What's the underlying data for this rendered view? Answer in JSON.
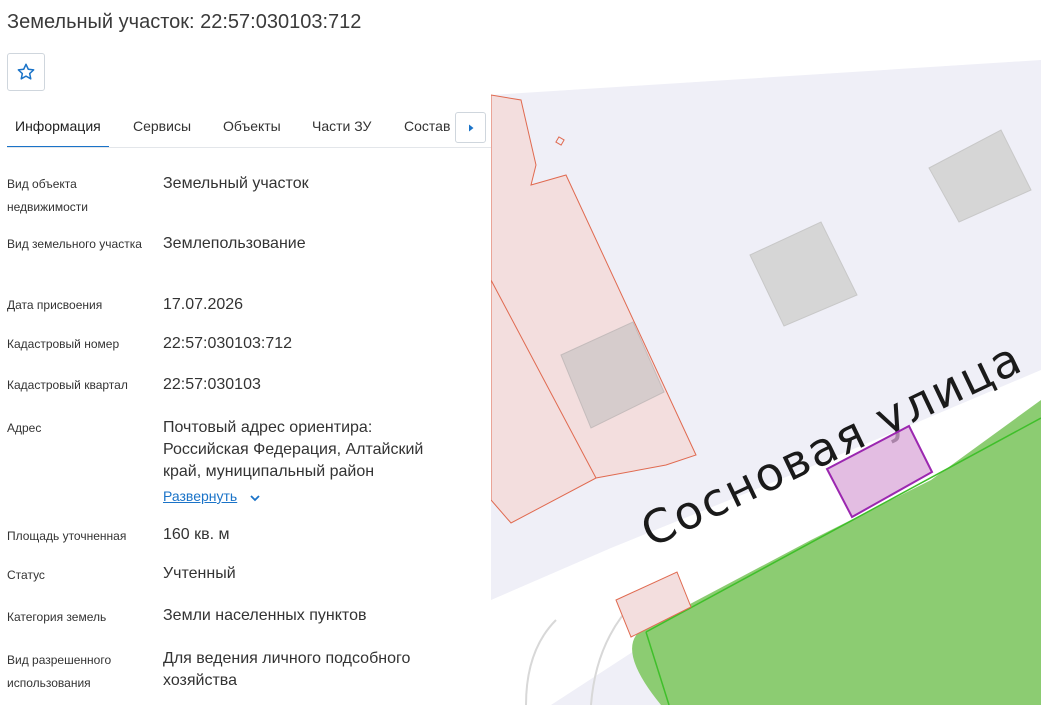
{
  "header": {
    "title": "Земельный участок: 22:57:030103:712"
  },
  "favorite": {
    "icon": "star-icon"
  },
  "tabs": [
    {
      "label": "Информация",
      "active": true
    },
    {
      "label": "Сервисы"
    },
    {
      "label": "Объекты"
    },
    {
      "label": "Части ЗУ"
    },
    {
      "label": "Состав"
    }
  ],
  "tab_scroll_icon": "caret-right-icon",
  "info": [
    {
      "label": "Вид объекта недвижимости",
      "value": "Земельный участок"
    },
    {
      "label": "Вид земельного участка",
      "value": "Землепользование"
    },
    {
      "label": "Дата присвоения",
      "value": "17.07.2026"
    },
    {
      "label": "Кадастровый номер",
      "value": "22:57:030103:712"
    },
    {
      "label": "Кадастровый квартал",
      "value": "22:57:030103"
    },
    {
      "label": "Адрес",
      "value": "Почтовый адрес ориентира: Российская Федерация, Алтайский край, муниципальный район"
    },
    {
      "label": "Площадь уточненная",
      "value": "160 кв. м"
    },
    {
      "label": "Статус",
      "value": "Учтенный"
    },
    {
      "label": "Категория земель",
      "value": "Земли населенных пунктов"
    },
    {
      "label": "Вид разрешенного использования",
      "value": "Для ведения личного подсобного хозяйства"
    }
  ],
  "address_expand": {
    "label": "Развернуть",
    "icon": "chevron-down-icon"
  },
  "map": {
    "street_label": "Сосновая улица",
    "colors": {
      "background": "#efeff7",
      "parcel_fill": "#f3dede",
      "parcel_stroke": "#e06a50",
      "building": "#d6d6d6",
      "green": "#8ccc72",
      "selected_stroke": "#9b27b0",
      "selected_fill": "#d9a7d8",
      "road": "#ffffff"
    }
  }
}
